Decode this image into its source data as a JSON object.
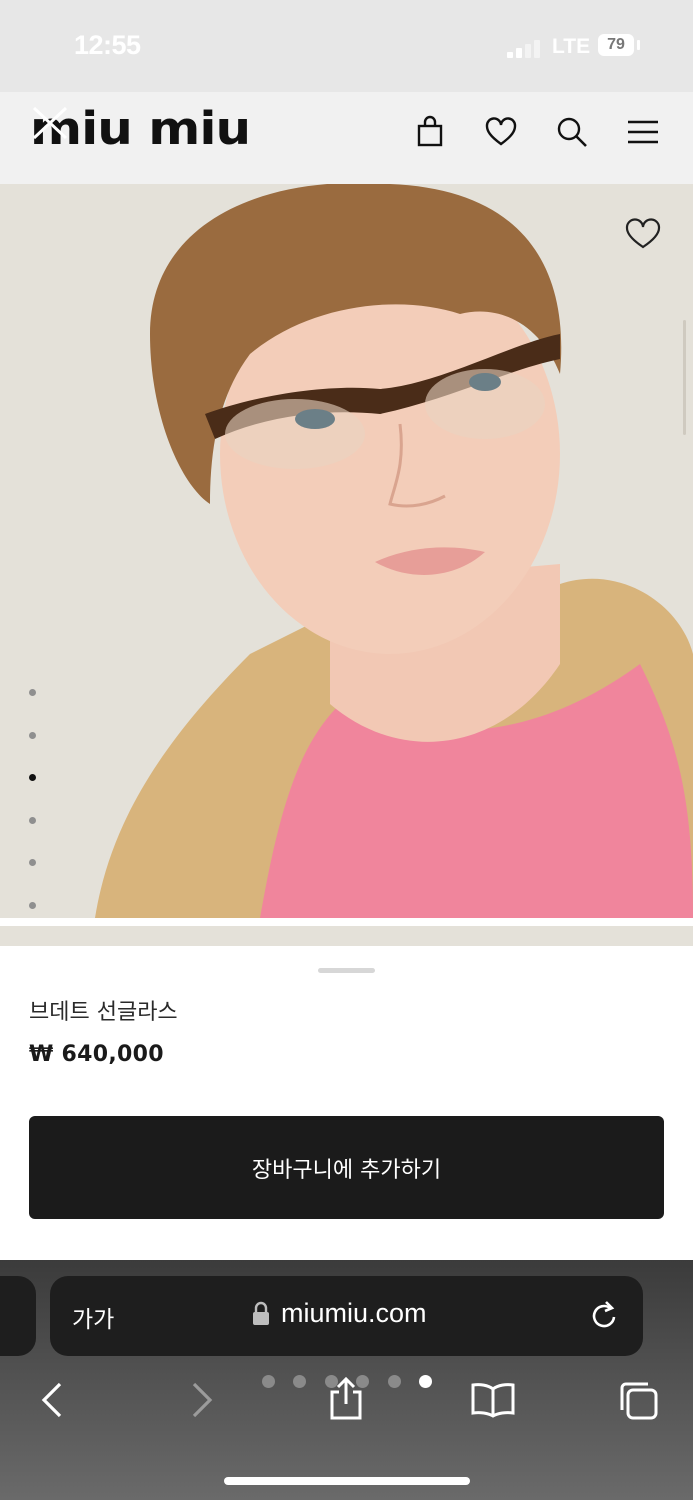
{
  "status_bar": {
    "time": "12:55",
    "network": "LTE",
    "battery": "79"
  },
  "header": {
    "logo": "miu miu",
    "icons": [
      "shopping-bag-icon",
      "heart-icon",
      "search-icon",
      "menu-icon"
    ]
  },
  "hero": {
    "image_description": "Model wearing tortoiseshell half-rim glasses, pink top and shearling jacket",
    "carousel_dots_count": 6,
    "carousel_active_index": 2
  },
  "product": {
    "name": "브데트 선글라스",
    "price": "₩ 640,000",
    "add_to_cart_label": "장바구니에 추가하기"
  },
  "browser": {
    "text_size_label": "가가",
    "url": "miumiu.com",
    "tab_dots_count": 6,
    "tab_active_index": 5
  },
  "colors": {
    "button_bg": "#1b1b1b",
    "hero_bg": "#e4e1d9",
    "sweater_pink": "#f0859c"
  }
}
